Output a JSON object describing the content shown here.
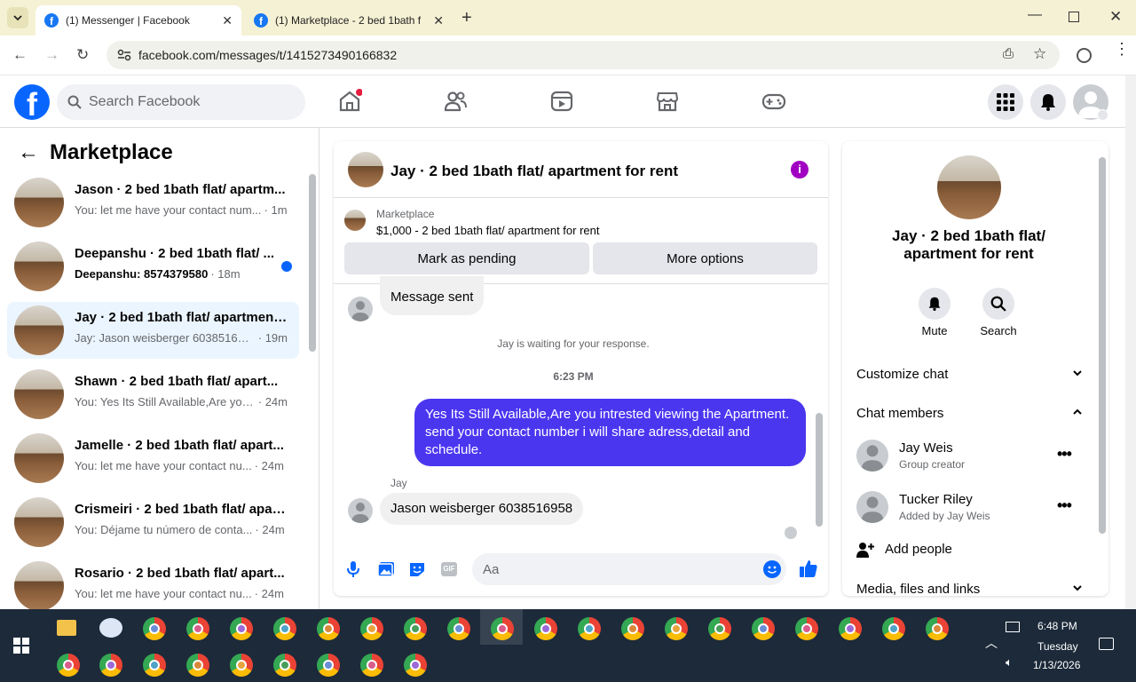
{
  "browser": {
    "tabs": [
      {
        "title": "(1) Messenger | Facebook",
        "active": true
      },
      {
        "title": "(1) Marketplace - 2 bed 1bath f",
        "active": false
      }
    ],
    "url": "facebook.com/messages/t/1415273490166832"
  },
  "fb": {
    "search_placeholder": "Search Facebook"
  },
  "left": {
    "title": "Marketplace",
    "conversations": [
      {
        "name": "Jason · 2 bed 1bath flat/ apartm...",
        "snippet": "You: let me have your contact num...",
        "time": "· 1m",
        "unread": false
      },
      {
        "name": "Deepanshu · 2 bed 1bath flat/ ...",
        "snippet": "Deepanshu: 8574379580",
        "time": "· 18m",
        "unread": true
      },
      {
        "name": "Jay · 2 bed 1bath flat/ apartment...",
        "snippet": "Jay: Jason weisberger 6038516958",
        "time": "· 19m",
        "unread": false,
        "selected": true
      },
      {
        "name": "Shawn · 2 bed 1bath flat/ apart...",
        "snippet": "You: Yes Its Still Available,Are you ...",
        "time": "· 24m",
        "unread": false
      },
      {
        "name": "Jamelle · 2 bed 1bath flat/ apart...",
        "snippet": "You: let me have your contact nu...",
        "time": "· 24m",
        "unread": false
      },
      {
        "name": "Crismeiri · 2 bed 1bath flat/ apar...",
        "snippet": "You: Déjame tu número de conta...",
        "time": "· 24m",
        "unread": false
      },
      {
        "name": "Rosario · 2 bed 1bath flat/ apart...",
        "snippet": "You: let me have your contact nu...",
        "time": "· 24m",
        "unread": false
      }
    ]
  },
  "chat": {
    "header_title": "Jay · 2 bed 1bath flat/ apartment for rent",
    "listing_label": "Marketplace",
    "listing_detail": "$1,000 - 2 bed 1bath flat/ apartment for rent",
    "btn_pending": "Mark as pending",
    "btn_more": "More options",
    "msg_sent": "Message sent",
    "waiting_note": "Jay is waiting for your response.",
    "timestamp": "6:23 PM",
    "outgoing": "Yes Its Still Available,Are you intrested viewing the Apartment. send your contact number i will share adress,detail and schedule.",
    "incoming_sender": "Jay",
    "incoming": "Jason weisberger 6038516958",
    "composer_placeholder": "Aa",
    "accent": "#4b36f0"
  },
  "right": {
    "title": "Jay · 2 bed 1bath flat/ apartment for rent",
    "mute": "Mute",
    "search": "Search",
    "customize": "Customize chat",
    "members_header": "Chat members",
    "members": [
      {
        "name": "Jay Weis",
        "role": "Group creator"
      },
      {
        "name": "Tucker Riley",
        "role": "Added by Jay Weis"
      }
    ],
    "add_people": "Add people",
    "media": "Media, files and links"
  },
  "taskbar": {
    "time": "6:48 PM",
    "day": "Tuesday",
    "date": "1/13/2026"
  }
}
